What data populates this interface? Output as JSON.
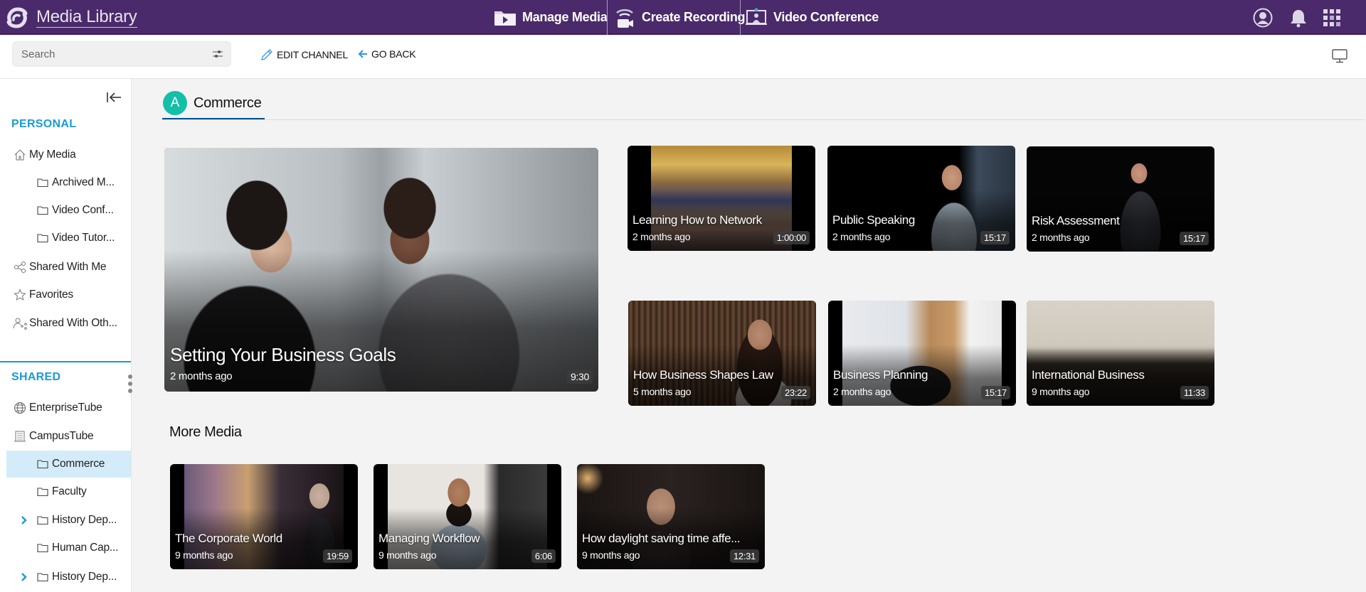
{
  "header": {
    "app_title": "Media Library",
    "nav": [
      {
        "label": "Manage Media",
        "icon": "media-folder-icon"
      },
      {
        "label": "Create Recording",
        "icon": "recording-camera-icon"
      },
      {
        "label": "Video Conference",
        "icon": "video-conference-icon"
      }
    ],
    "right_icons": [
      "user-account-icon",
      "notification-bell-icon",
      "app-grid-icon"
    ],
    "color": "#4a2a6a"
  },
  "toolbar": {
    "search_placeholder": "Search",
    "search_value": "",
    "edit_channel_label": "EDIT CHANNEL",
    "go_back_label": "GO BACK"
  },
  "sidebar": {
    "personal_title": "PERSONAL",
    "personal_items": [
      {
        "label": "My Media",
        "icon": "home-icon",
        "level": 0
      },
      {
        "label": "Archived M...",
        "icon": "folder-icon",
        "level": 1
      },
      {
        "label": "Video Conf...",
        "icon": "folder-icon",
        "level": 1
      },
      {
        "label": "Video Tutor...",
        "icon": "folder-icon",
        "level": 1
      },
      {
        "label": "Shared With Me",
        "icon": "share-icon",
        "level": 0
      },
      {
        "label": "Favorites",
        "icon": "star-icon",
        "level": 0
      },
      {
        "label": "Shared With Oth...",
        "icon": "user-share-icon",
        "level": 0
      }
    ],
    "shared_title": "SHARED",
    "shared_items": [
      {
        "label": "EnterpriseTube",
        "icon": "globe-icon",
        "level": 0
      },
      {
        "label": "CampusTube",
        "icon": "building-icon",
        "level": 0
      },
      {
        "label": "Commerce",
        "icon": "folder-icon",
        "level": 1,
        "active": true
      },
      {
        "label": "Faculty",
        "icon": "folder-icon",
        "level": 1
      },
      {
        "label": "History Dep...",
        "icon": "folder-icon",
        "level": 1,
        "expandable": true
      },
      {
        "label": "Human Cap...",
        "icon": "folder-icon",
        "level": 1
      },
      {
        "label": "History Dep...",
        "icon": "folder-icon",
        "level": 1,
        "expandable": true
      }
    ],
    "accent_color": "#1a9ad6"
  },
  "channel": {
    "avatar_letter": "A",
    "name": "Commerce",
    "avatar_color": "#13bfa6"
  },
  "featured": {
    "title": "Setting Your Business Goals",
    "age": "2 months ago",
    "duration": "9:30"
  },
  "grid": [
    {
      "title": "Learning How to Network",
      "age": "2 months ago",
      "duration": "1:00:00"
    },
    {
      "title": "Public Speaking",
      "age": "2 months ago",
      "duration": "15:17"
    },
    {
      "title": "Risk Assessment",
      "age": "2 months ago",
      "duration": "15:17"
    },
    {
      "title": "How Business Shapes Law",
      "age": "5 months ago",
      "duration": "23:22"
    },
    {
      "title": "Business Planning",
      "age": "2 months ago",
      "duration": "15:17"
    },
    {
      "title": "International Business",
      "age": "9 months ago",
      "duration": "11:33"
    }
  ],
  "more_media": {
    "title": "More Media",
    "items": [
      {
        "title": "The Corporate World",
        "age": "9 months ago",
        "duration": "19:59"
      },
      {
        "title": "Managing Workflow",
        "age": "9 months ago",
        "duration": "6:06"
      },
      {
        "title": "How daylight saving time affe...",
        "age": "9 months ago",
        "duration": "12:31"
      }
    ]
  }
}
